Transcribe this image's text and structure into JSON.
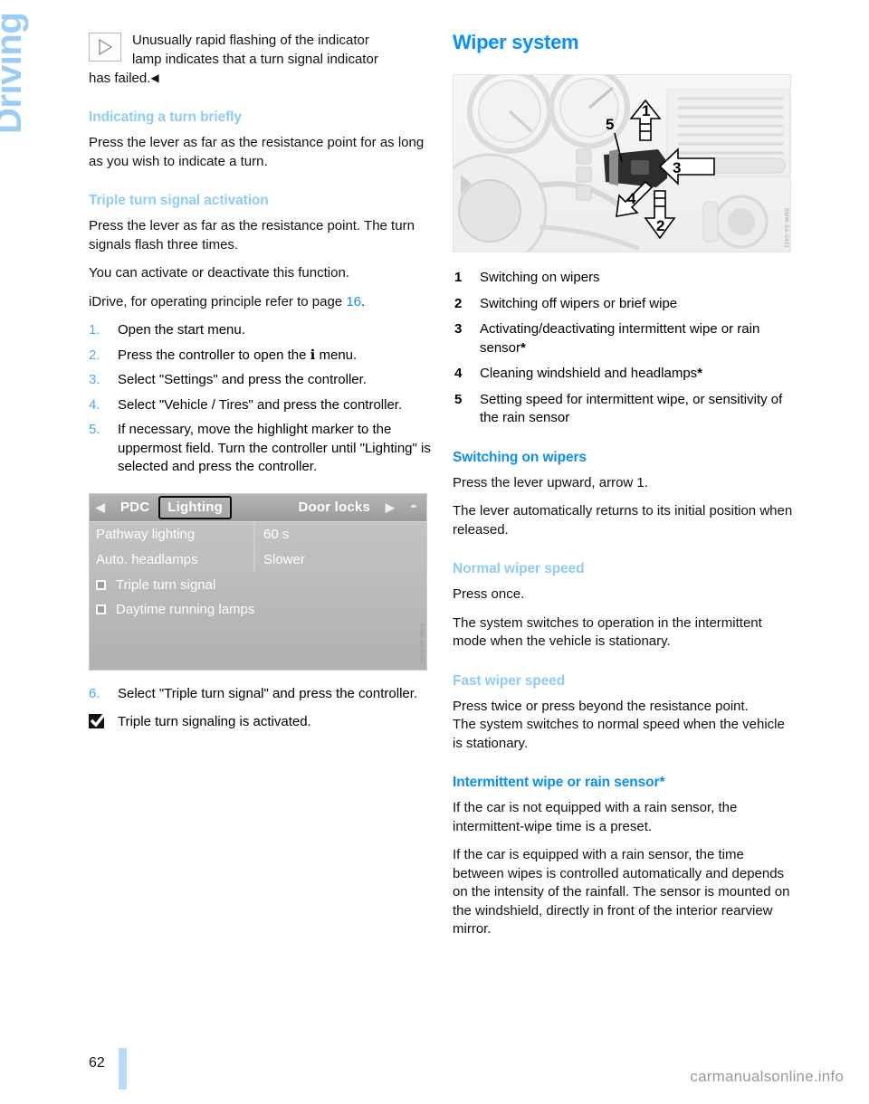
{
  "chapter_tab": "Driving",
  "page_number": "62",
  "watermark": "carmanualsonline.info",
  "left_column": {
    "note": {
      "icon": "play-triangle-icon",
      "line1": "Unusually rapid flashing of the indicator",
      "line2": "lamp indicates that a turn signal indicator",
      "line3": "has failed.",
      "end_marker": "◀"
    },
    "section_indicating": {
      "heading": "Indicating a turn briefly",
      "paragraph": "Press the lever as far as the resistance point for as long as you wish to indicate a turn."
    },
    "section_triple": {
      "heading": "Triple turn signal activation",
      "para1": "Press the lever as far as the resistance point. The turn signals flash three times.",
      "para2": "You can activate or deactivate this function.",
      "para3_prefix": "iDrive, for operating principle refer to page ",
      "para3_ref": "16",
      "para3_suffix": ".",
      "steps": [
        {
          "num": "1.",
          "text": "Open the start menu."
        },
        {
          "num": "2.",
          "text": "Press the controller to open the ℹ menu."
        },
        {
          "num": "3.",
          "text": "Select \"Settings\" and press the controller."
        },
        {
          "num": "4.",
          "text": "Select \"Vehicle / Tires\" and press the controller."
        },
        {
          "num": "5.",
          "text": "If necessary, move the highlight marker to the uppermost field. Turn the controller until \"Lighting\" is selected and press the controller."
        }
      ],
      "step6": {
        "num": "6.",
        "text": "Select \"Triple turn signal\" and press the controller."
      },
      "activated_text": "Triple turn signaling is activated.",
      "activated_icon": "checked-checkbox-icon"
    },
    "idrive_screenshot": {
      "image_name": "idrive-lighting-menu-screenshot",
      "left_arrow_icon": "chevron-left-icon",
      "right_arrow_icon": "chevron-right-icon",
      "knob_icon": "updown-knob-icon",
      "tabs": [
        {
          "label": "PDC",
          "active": false
        },
        {
          "label": "Lighting",
          "active": true
        },
        {
          "label": "Door locks",
          "active": false
        }
      ],
      "rows": [
        {
          "label": "Pathway lighting",
          "value": "60 s"
        },
        {
          "label": "Auto. headlamps",
          "value": "Slower"
        }
      ],
      "checkboxes": [
        {
          "label": "Triple turn signal",
          "checked": false
        },
        {
          "label": "Daytime running lamps",
          "checked": false
        }
      ],
      "watermark": "BMW-SA-0402"
    }
  },
  "right_column": {
    "title": "Wiper system",
    "illustration": {
      "image_name": "wiper-stalk-dashboard-illustration",
      "callouts": [
        "1",
        "2",
        "3",
        "4",
        "5"
      ],
      "watermark": "BMW-SA-0401"
    },
    "legend": [
      {
        "num": "1",
        "text": "Switching on wipers",
        "star": ""
      },
      {
        "num": "2",
        "text": "Switching off wipers or brief wipe",
        "star": ""
      },
      {
        "num": "3",
        "text": "Activating/deactivating intermittent wipe or rain sensor",
        "star": "*"
      },
      {
        "num": "4",
        "text": "Cleaning windshield and headlamps",
        "star": "*"
      },
      {
        "num": "5",
        "text": "Setting speed for intermittent wipe, or sensitivity of the rain sensor",
        "star": ""
      }
    ],
    "section_switching": {
      "heading": "Switching on wipers",
      "para1": "Press the lever upward, arrow 1.",
      "para2": "The lever automatically returns to its initial position when released."
    },
    "section_normal": {
      "heading": "Normal wiper speed",
      "para1": "Press once.",
      "para2": "The system switches to operation in the intermittent mode when the vehicle is stationary."
    },
    "section_fast": {
      "heading": "Fast wiper speed",
      "para1": "Press twice or press beyond the resistance point.",
      "para2": "The system switches to normal speed when the vehicle is stationary."
    },
    "section_intermittent": {
      "heading": "Intermittent wipe or rain sensor*",
      "para1": "If the car is not equipped with a rain sensor, the intermittent-wipe time is a preset.",
      "para2": "If the car is equipped with a rain sensor, the time between wipes is controlled automatically and depends on the intensity of the rainfall. The sensor is mounted on the windshield, directly in front of the interior rearview mirror."
    }
  },
  "colors": {
    "heading_strong": "#0a8ef7",
    "heading_light": "#8ecbf5",
    "tab_blue": "#9ccef4",
    "step_number": "#4aa8ee",
    "footer_bar": "#b8dcf7"
  }
}
